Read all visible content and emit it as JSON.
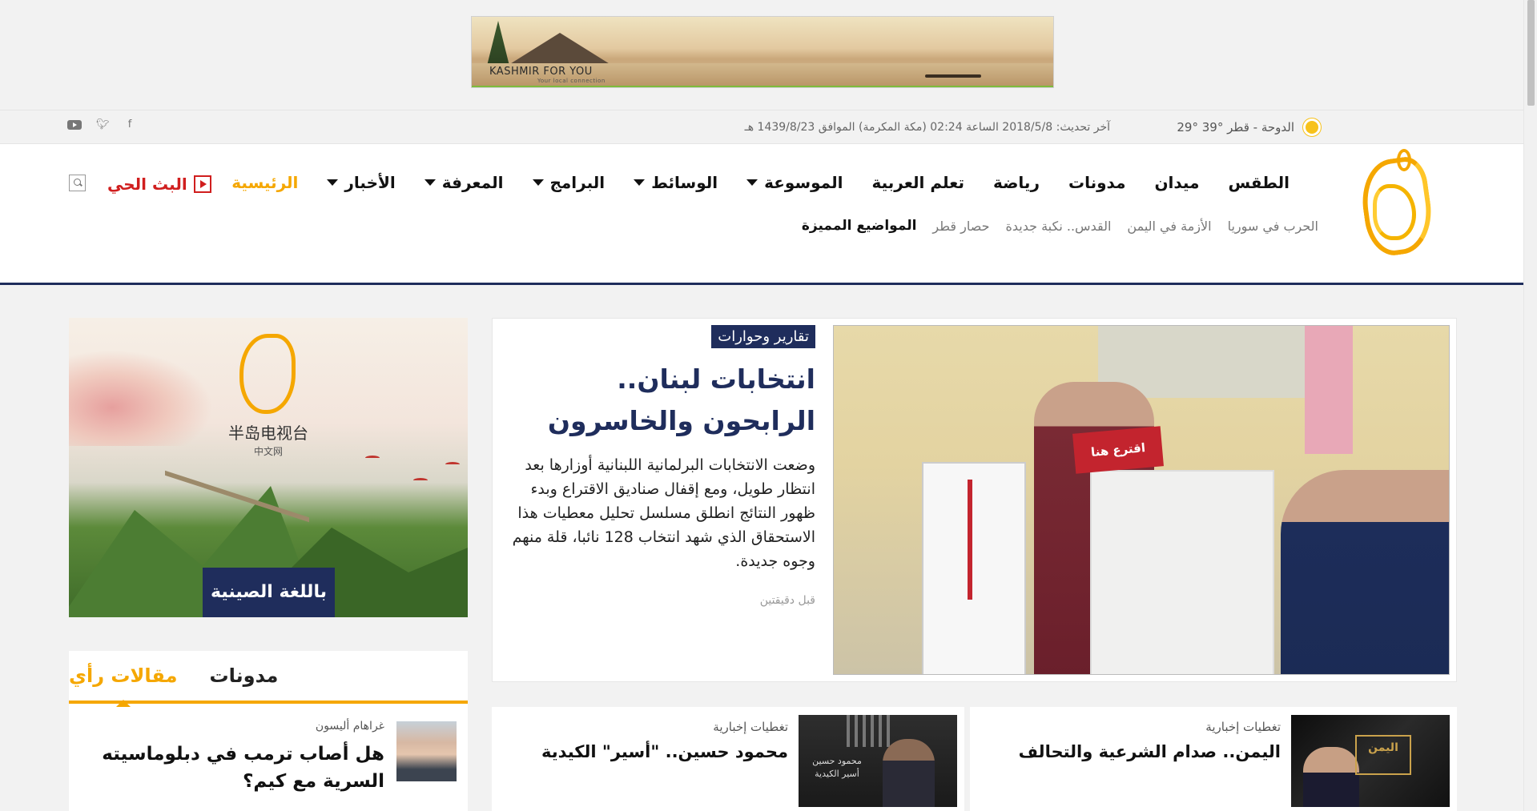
{
  "ad": {
    "brand": "KASHMIR FOR YOU",
    "tagline": "Your local connection"
  },
  "topbar": {
    "weather": "الدوحة - قطر °39 °29",
    "updated": "آخر تحديث: 2018/5/8 الساعة 02:24 (مكة المكرمة) الموافق 1439/8/23 هـ",
    "social": [
      "facebook-icon",
      "twitter-icon",
      "youtube-icon"
    ]
  },
  "nav": {
    "items": [
      {
        "label": "الرئيسية",
        "active": true,
        "dropdown": false
      },
      {
        "label": "الأخبار",
        "active": false,
        "dropdown": true
      },
      {
        "label": "المعرفة",
        "active": false,
        "dropdown": true
      },
      {
        "label": "البرامج",
        "active": false,
        "dropdown": true
      },
      {
        "label": "الوسائط",
        "active": false,
        "dropdown": true
      },
      {
        "label": "الموسوعة",
        "active": false,
        "dropdown": true
      },
      {
        "label": "تعلم العربية",
        "active": false,
        "dropdown": false
      },
      {
        "label": "رياضة",
        "active": false,
        "dropdown": false
      },
      {
        "label": "مدونات",
        "active": false,
        "dropdown": false
      },
      {
        "label": "ميدان",
        "active": false,
        "dropdown": false
      },
      {
        "label": "الطقس",
        "active": false,
        "dropdown": false
      }
    ],
    "live_label": "البث الحي"
  },
  "featured": {
    "label": "المواضيع المميزة",
    "tags": [
      "حصار قطر",
      "القدس.. نكبة جديدة",
      "الأزمة في اليمن",
      "الحرب في سوريا"
    ]
  },
  "main_story": {
    "section": "تقارير وحوارات",
    "title": "انتخابات لبنان.. الرابحون والخاسرون",
    "summary": "وضعت الانتخابات البرلمانية اللبنانية أوزارها بعد انتظار طويل، ومع إقفال صناديق الاقتراع وبدء ظهور النتائج انطلق مسلسل تحليل معطيات هذا الاستحقاق الذي شهد انتخاب 128 نائبا، قلة منهم وجوه جديدة.",
    "time": "قبل دقيقتين",
    "photo_sign": "اقترع هنا"
  },
  "promo": {
    "chinese_title": "半岛电视台",
    "chinese_sub": "中文网",
    "cta": "باللغة الصينية"
  },
  "opinions": {
    "tabs": [
      {
        "label": "مقالات رأي",
        "active": true
      },
      {
        "label": "مدونات",
        "active": false
      }
    ],
    "item": {
      "author": "غراهام أليسون",
      "title": "هل أصاب ترمب في دبلوماسيته السرية مع كيم؟"
    }
  },
  "news": [
    {
      "section": "تغطيات إخبارية",
      "title": "اليمن.. صدام الشرعية والتحالف",
      "thumb_text": "اليمن"
    },
    {
      "section": "تغطيات إخبارية",
      "title": "محمود حسين.. \"أسير\" الكيدية",
      "thumb_text": "محمود حسين أسير الكيدية"
    }
  ]
}
